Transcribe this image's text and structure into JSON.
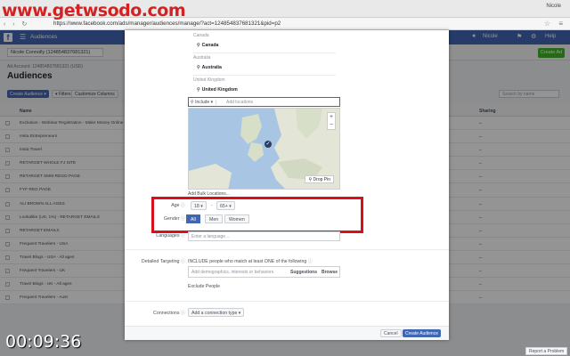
{
  "watermark": "www.getwsodo.com",
  "browser": {
    "window_title": "Nicole",
    "url": "https://www.facebook.com/ads/manager/audiences/manage/?act=124854837681321&pid=p2",
    "nav_glyphs": "‹ › ↻"
  },
  "fbbar": {
    "title": "Audiences",
    "user": "Nicole",
    "help": "Help"
  },
  "subbar": {
    "account": "Nicole Connolly (124854837681321)",
    "create_ad": "Create Ad"
  },
  "page": {
    "account_id": "Ad Account: 124854837681321 (USD)",
    "heading": "Audiences",
    "create_audience": "Create Audience ▾",
    "filters": "▾ Filters ▾",
    "customize_columns": "Customize Columns",
    "search_placeholder": "Search by name",
    "col_name": "Name",
    "col_sharing": "Sharing"
  },
  "rows": [
    "Exclusion - Webinar Registration - Make Money Online",
    "Insta Entrepreneurs",
    "Insta Travel",
    "RETARGET WHOLE FJ SITE",
    "RETARGET SMM REGO PAGE",
    "FYF REG PAGE",
    "ALI BROWN ALL AGES",
    "Lookalike (US, 1%) - RETARGET EMAILS",
    "RETARGET EMAILS",
    "Frequent Travelers - USA",
    "Travel Blogs - USA - All ages",
    "Frequent Travelers - UK",
    "Travel Blogs - UK - All ages",
    "Frequent Travelers - Aust"
  ],
  "modal": {
    "locations": [
      {
        "group": "Canada",
        "item": "Canada"
      },
      {
        "group": "Australia",
        "item": "Australia"
      },
      {
        "group": "United Kingdom",
        "item": "United Kingdom"
      }
    ],
    "include_label": "Include ▾",
    "location_placeholder": "Add locations",
    "drop_pin": "Drop Pin",
    "add_bulk": "Add Bulk Locations...",
    "age_label": "Age",
    "age_min": "18 ▾",
    "age_dash": "-",
    "age_max": "65+ ▾",
    "gender_label": "Gender",
    "gender_all": "All",
    "gender_men": "Men",
    "gender_women": "Women",
    "languages_label": "Languages",
    "languages_placeholder": "Enter a language...",
    "detailed_label": "Detailed Targeting",
    "detailed_text": "INCLUDE people who match at least ONE of the following",
    "detailed_placeholder": "Add demographics, interests or behaviors",
    "suggestions": "Suggestions",
    "browse": "Browse",
    "exclude_people": "Exclude People",
    "connections_label": "Connections",
    "connections_btn": "Add a connection type ▾",
    "cancel": "Cancel",
    "create_audience": "Create Audience"
  },
  "footer": {
    "report": "Report a Problem"
  },
  "timestamp": "00:09:36",
  "colors": {
    "fb_blue": "#4267b2",
    "highlight": "#d8101a",
    "green": "#42b72a"
  }
}
